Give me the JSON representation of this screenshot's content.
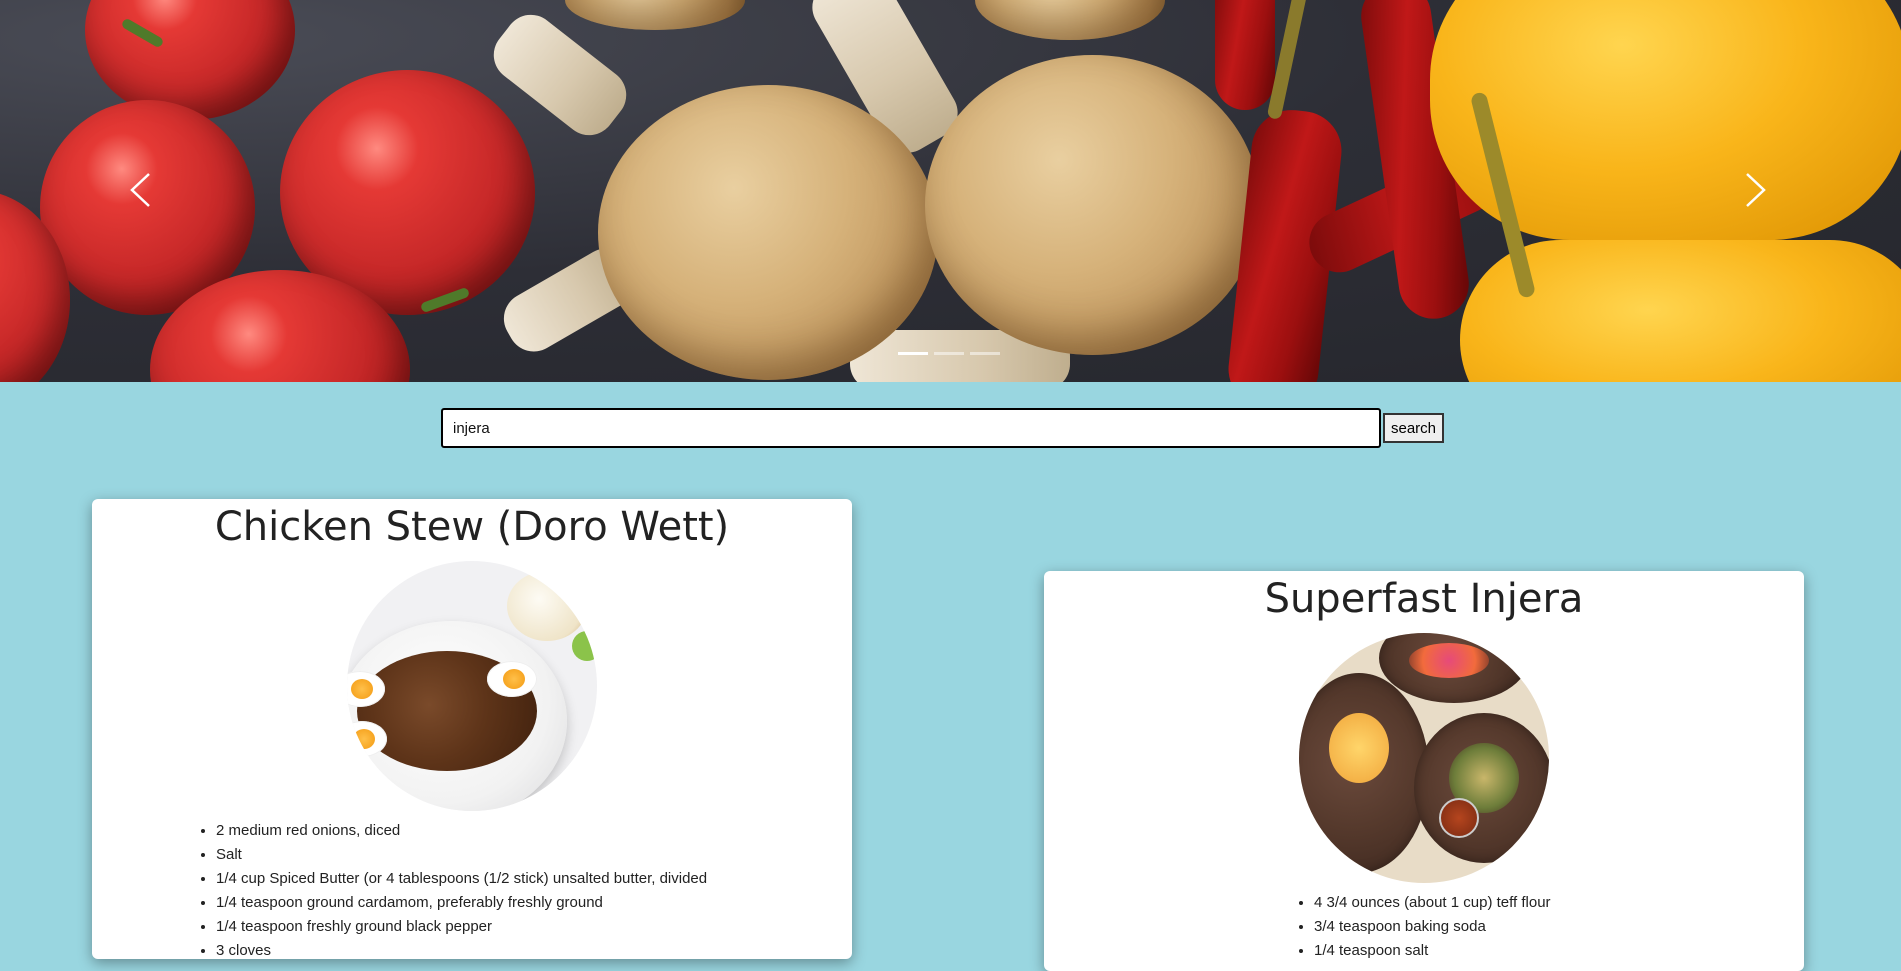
{
  "carousel": {
    "prev_label": "Previous",
    "next_label": "Next",
    "indicators": [
      "slide-1",
      "slide-2",
      "slide-3"
    ],
    "active_index": 0
  },
  "search": {
    "value": "injera",
    "button_label": "search"
  },
  "recipes": [
    {
      "title": "Chicken Stew (Doro Wett)",
      "ingredients": [
        "2 medium red onions, diced",
        "Salt",
        "1/4 cup Spiced Butter (or 4 tablespoons (1/2 stick) unsalted butter, divided",
        "1/4 teaspoon ground cardamom, preferably freshly ground",
        "1/4 teaspoon freshly ground black pepper",
        "3 cloves"
      ]
    },
    {
      "title": "Superfast Injera",
      "ingredients": [
        "4 3/4 ounces (about 1 cup) teff flour",
        "3/4 teaspoon baking soda",
        "1/4 teaspoon salt"
      ]
    }
  ],
  "colors": {
    "page_background": "#99d6e0",
    "card_background": "#ffffff",
    "indicator_active": "#ffffff"
  }
}
